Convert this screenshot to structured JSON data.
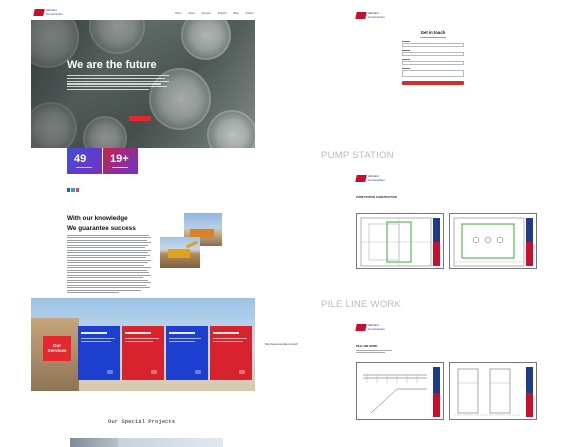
{
  "nav": {
    "logo_text": "Alkhalid\nConstruction",
    "links": [
      "Home",
      "About",
      "Services",
      "Projects",
      "Blog",
      "Contact"
    ]
  },
  "hero": {
    "title": "We are the future",
    "button_label": ""
  },
  "stats": [
    {
      "value": "49",
      "color": "#3b4fd8"
    },
    {
      "value": "19+",
      "color": "#c8234a"
    }
  ],
  "about": {
    "heading_line1": "With our knowledge",
    "heading_line2": "We guarantee success"
  },
  "services": {
    "label": "Our Services",
    "columns": [
      {
        "color": "#1d3fd0"
      },
      {
        "color": "#d8232f"
      },
      {
        "color": "#1d3fd0"
      },
      {
        "color": "#d8232f"
      }
    ]
  },
  "link_text": "http://www.example.com/pdf",
  "special_projects_title": "Our Special Projects",
  "contact": {
    "title": "Get in touch"
  },
  "sections": {
    "pump_station": "PUMP STATION",
    "pile_line_work": "PILE LINE WORK"
  },
  "documents": {
    "pump_caption": "PUMP STATION CONSTRUCTION",
    "pile_caption": "PILE LINE WORK"
  },
  "colors": {
    "brand_red": "#c8102e",
    "brand_blue": "#1e3a8a",
    "cta_red": "#e3282e"
  }
}
